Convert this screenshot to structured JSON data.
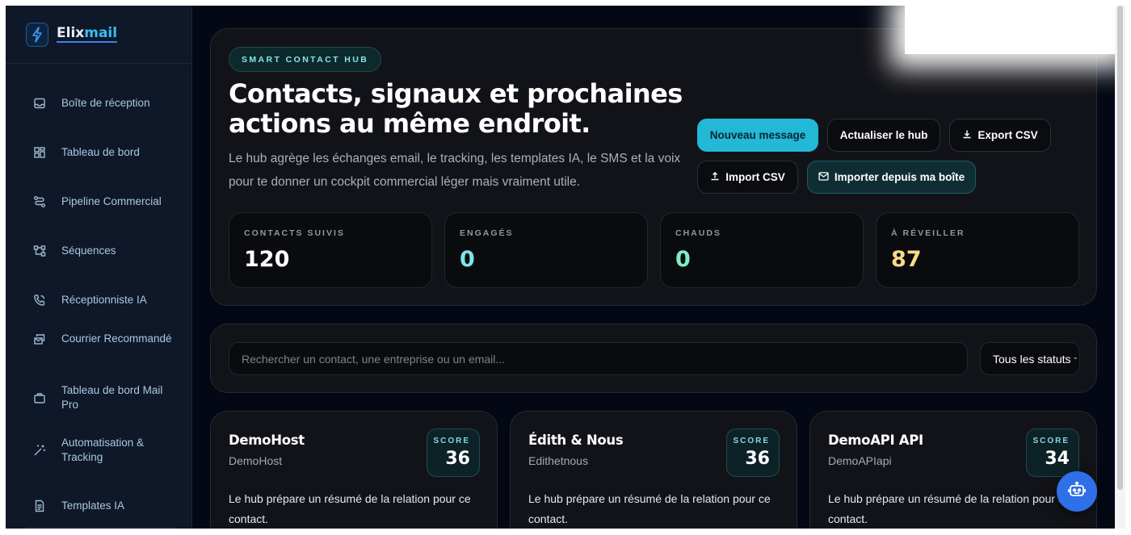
{
  "brand": {
    "prefix": "Elix",
    "accent": "mail",
    "icon": "lightning-icon"
  },
  "sidebar": {
    "items": [
      {
        "label": "Boîte de réception",
        "icon": "inbox-icon"
      },
      {
        "label": "Tableau de bord",
        "icon": "dashboard-grid-icon"
      },
      {
        "label": "Pipeline Commercial",
        "icon": "route-icon"
      },
      {
        "label": "Séquences",
        "icon": "workflow-icon"
      },
      {
        "label": "Réceptionniste IA",
        "icon": "phone-call-icon"
      },
      {
        "label": "Courrier Recommandé",
        "icon": "mail-stack-icon"
      },
      {
        "label": "Tableau de bord Mail Pro",
        "icon": "briefcase-icon"
      },
      {
        "label": "Automatisation & Tracking",
        "icon": "magic-wand-icon"
      },
      {
        "label": "Templates IA",
        "icon": "document-icon"
      }
    ]
  },
  "hero": {
    "pill": "SMART CONTACT HUB",
    "title": "Contacts, signaux et prochaines actions au même endroit.",
    "description": "Le hub agrège les échanges email, le tracking, les templates IA, le SMS et la voix pour te donner un cockpit commercial léger mais vraiment utile.",
    "buttons": {
      "new_message": "Nouveau message",
      "refresh": "Actualiser le hub",
      "export": "Export CSV",
      "import": "Import CSV",
      "import_inbox": "Importer depuis ma boîte"
    }
  },
  "stats": [
    {
      "label": "CONTACTS SUIVIS",
      "value": "120",
      "color": "#ffffff"
    },
    {
      "label": "ENGAGÉS",
      "value": "0",
      "color": "#7fe3ea"
    },
    {
      "label": "CHAUDS",
      "value": "0",
      "color": "#7eeec3"
    },
    {
      "label": "À RÉVEILLER",
      "value": "87",
      "color": "#f7dc86"
    }
  ],
  "search": {
    "placeholder": "Rechercher un contact, une entreprise ou un email...",
    "status_filter": "Tous les statuts"
  },
  "cards": [
    {
      "name": "DemoHost",
      "subtitle": "DemoHost",
      "score_label": "SCORE",
      "score": "36",
      "summary": "Le hub prépare un résumé de la relation pour ce contact."
    },
    {
      "name": "Édith & Nous",
      "subtitle": "Edithetnous",
      "score_label": "SCORE",
      "score": "36",
      "summary": "Le hub prépare un résumé de la relation pour ce contact."
    },
    {
      "name": "DemoAPI API",
      "subtitle": "DemoAPIapi",
      "score_label": "SCORE",
      "score": "34",
      "summary": "Le hub prépare un résumé de la relation pour ce contact."
    }
  ],
  "fab": {
    "icon": "robot-icon"
  },
  "colors": {
    "accent": "#22b8d6",
    "background": "#030814",
    "fab": "#2f6fe8"
  }
}
